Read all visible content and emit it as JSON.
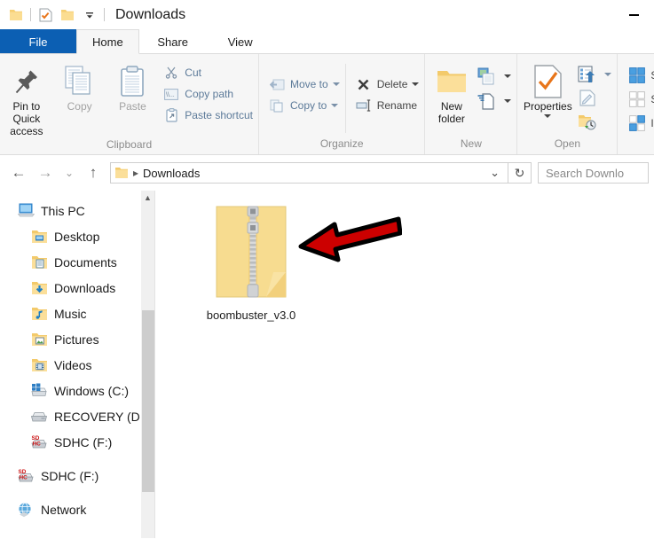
{
  "window": {
    "title": "Downloads",
    "minimize_label": "Minimize",
    "quick_access": [
      {
        "name": "folder-icon",
        "label": "Explorer"
      },
      {
        "name": "properties-icon",
        "label": "Properties"
      },
      {
        "name": "new-folder-icon",
        "label": "New folder"
      },
      {
        "name": "chevron-down-icon",
        "label": "Customize Quick Access Toolbar"
      }
    ]
  },
  "ribbon": {
    "tabs": [
      {
        "label": "File",
        "id": "file"
      },
      {
        "label": "Home",
        "id": "home"
      },
      {
        "label": "Share",
        "id": "share"
      },
      {
        "label": "View",
        "id": "view"
      }
    ],
    "active_tab": "Home",
    "groups": [
      {
        "label": "Clipboard",
        "big_buttons": [
          {
            "label": "Pin to Quick access",
            "icon": "pin-icon",
            "enabled": true
          },
          {
            "label": "Copy",
            "icon": "copy-icon",
            "enabled": false
          },
          {
            "label": "Paste",
            "icon": "paste-icon",
            "enabled": false
          }
        ],
        "small_buttons": [
          {
            "label": "Cut",
            "icon": "scissors-icon"
          },
          {
            "label": "Copy path",
            "icon": "copy-path-icon"
          },
          {
            "label": "Paste shortcut",
            "icon": "paste-shortcut-icon"
          }
        ]
      },
      {
        "label": "Organize",
        "small_buttons": [
          {
            "label": "Move to",
            "icon": "move-to-icon",
            "caret": true
          },
          {
            "label": "Copy to",
            "icon": "copy-to-icon",
            "caret": true
          },
          {
            "label": "Delete",
            "icon": "delete-icon",
            "caret": true
          },
          {
            "label": "Rename",
            "icon": "rename-icon",
            "caret": false
          }
        ]
      },
      {
        "label": "New",
        "big_buttons": [
          {
            "label": "New folder",
            "icon": "new-folder-icon",
            "enabled": true
          }
        ],
        "small_buttons": [
          {
            "label": "New item",
            "icon": "new-item-icon",
            "caret": true
          },
          {
            "label": "Easy access",
            "icon": "easy-access-icon",
            "caret": true
          }
        ]
      },
      {
        "label": "Open",
        "big_buttons": [
          {
            "label": "Properties",
            "icon": "properties-icon",
            "enabled": true,
            "caret": true
          }
        ],
        "small_buttons": [
          {
            "label": "Open",
            "icon": "open-icon",
            "caret": true
          },
          {
            "label": "Edit",
            "icon": "edit-icon",
            "caret": false
          },
          {
            "label": "History",
            "icon": "history-icon",
            "caret": false
          }
        ]
      },
      {
        "label": "",
        "small_buttons": [
          {
            "label": "Se",
            "icon": "select-all-icon",
            "caret": false
          },
          {
            "label": "Se",
            "icon": "select-none-icon",
            "caret": false
          },
          {
            "label": "In",
            "icon": "invert-selection-icon",
            "caret": false
          }
        ]
      }
    ]
  },
  "address_bar": {
    "back_label": "Back",
    "forward_label": "Forward",
    "recent_label": "Recent locations",
    "up_label": "Up one level",
    "breadcrumb": [
      "Downloads"
    ],
    "dropdown_label": "Previous locations",
    "refresh_label": "Refresh",
    "search_placeholder": "Search Downlo"
  },
  "nav_pane": {
    "items": [
      {
        "label": "This PC",
        "icon": "this-pc-icon",
        "level": 0,
        "gap": false
      },
      {
        "label": "Desktop",
        "icon": "desktop-folder-icon",
        "level": 1,
        "gap": false
      },
      {
        "label": "Documents",
        "icon": "documents-folder-icon",
        "level": 1,
        "gap": false
      },
      {
        "label": "Downloads",
        "icon": "downloads-folder-icon",
        "level": 1,
        "gap": false
      },
      {
        "label": "Music",
        "icon": "music-folder-icon",
        "level": 1,
        "gap": false
      },
      {
        "label": "Pictures",
        "icon": "pictures-folder-icon",
        "level": 1,
        "gap": false
      },
      {
        "label": "Videos",
        "icon": "videos-folder-icon",
        "level": 1,
        "gap": false
      },
      {
        "label": "Windows (C:)",
        "icon": "windows-drive-icon",
        "level": 1,
        "gap": false
      },
      {
        "label": "RECOVERY (D:)",
        "icon": "drive-icon",
        "level": 1,
        "gap": false
      },
      {
        "label": "SDHC (F:)",
        "icon": "sdhc-drive-icon",
        "level": 1,
        "gap": false
      },
      {
        "label": "SDHC (F:)",
        "icon": "sdhc-drive-icon",
        "level": 0,
        "gap": true
      },
      {
        "label": "Network",
        "icon": "network-icon",
        "level": 0,
        "gap": true
      }
    ]
  },
  "content": {
    "files": [
      {
        "name": "boombuster_v3.0",
        "icon": "zip-archive-icon",
        "selected": false
      }
    ],
    "annotation": {
      "name": "red-arrow-annotation",
      "color": "#cc0000",
      "outline": "#000000"
    }
  },
  "colors": {
    "accent": "#0c5fb3",
    "ribbon_bg": "#f6f6f6",
    "folder_yellow": "#fcdc8a",
    "arrow_red": "#cc0000"
  }
}
